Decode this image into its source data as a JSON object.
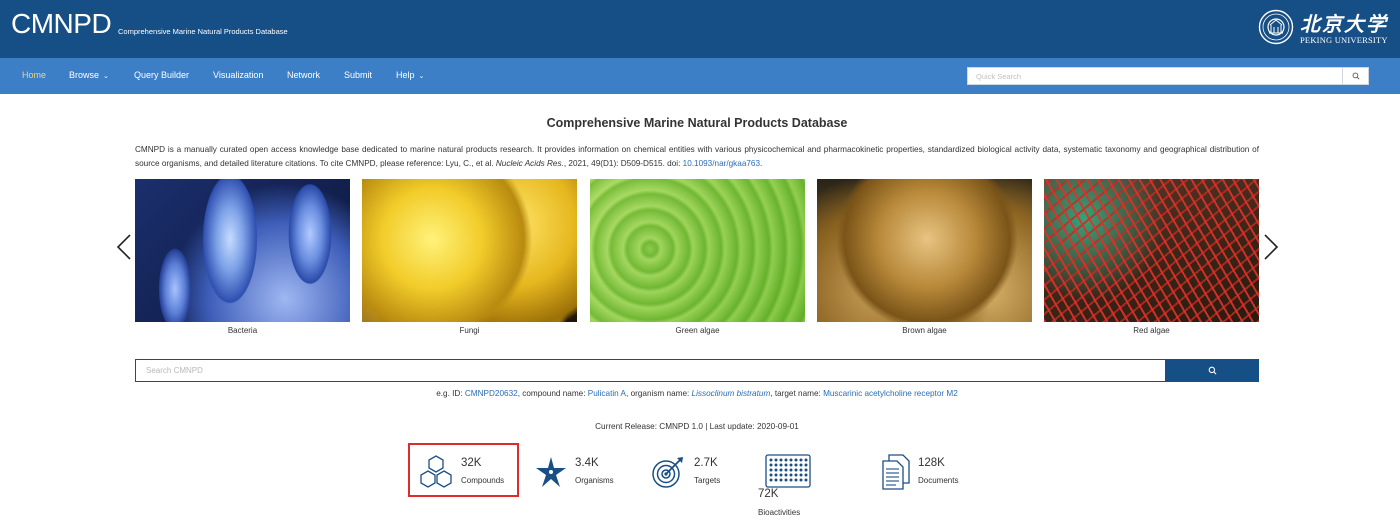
{
  "header": {
    "brand": "CMNPD",
    "brand_subtitle": "Comprehensive Marine Natural Products Database",
    "university_cn": "北京大学",
    "university_en": "PEKING UNIVERSITY"
  },
  "nav": {
    "items": [
      {
        "label": "Home",
        "active": true
      },
      {
        "label": "Browse",
        "dropdown": true
      },
      {
        "label": "Query Builder"
      },
      {
        "label": "Visualization"
      },
      {
        "label": "Network"
      },
      {
        "label": "Submit"
      },
      {
        "label": "Help",
        "dropdown": true
      }
    ],
    "caret": "⌄",
    "quick_search_placeholder": "Quick Search"
  },
  "main": {
    "title": "Comprehensive Marine Natural Products Database",
    "intro_text": "CMNPD is a manually curated open access knowledge base dedicated to marine natural products research. It provides information on chemical entities with various physicochemical and pharmacokinetic properties, standardized biological activity data, systematic taxonomy and geographical distribution of source organisms, and detailed literature citations. To cite CMNPD, please reference: Lyu, C., et al. ",
    "intro_journal": "Nucleic Acids Res.",
    "intro_cite_rest": ", 2021, 49(D1): D509-D515. doi: ",
    "intro_doi": "10.1093/nar/gkaa763",
    "intro_end": "."
  },
  "carousel": {
    "slides": [
      {
        "caption": "Bacteria"
      },
      {
        "caption": "Fungi"
      },
      {
        "caption": "Green algae"
      },
      {
        "caption": "Brown algae"
      },
      {
        "caption": "Red algae"
      }
    ]
  },
  "search": {
    "placeholder": "Search CMNPD",
    "eg_prefix": "e.g. ID: ",
    "eg_id": "CMNPD20632",
    "eg_compound_label": ", compound name: ",
    "eg_compound": "Pulicatin A",
    "eg_organism_label": ", organism name: ",
    "eg_organism": "Lissoclinum bistratum",
    "eg_target_label": ", target name: ",
    "eg_target": "Muscarinic acetylcholine receptor M2"
  },
  "release": {
    "text": "Current Release: CMNPD 1.0 | Last update: 2020-09-01"
  },
  "stats": [
    {
      "value": "32K",
      "label": "Compounds",
      "icon": "hexagon-molecule-icon"
    },
    {
      "value": "3.4K",
      "label": "Organisms",
      "icon": "starfish-icon"
    },
    {
      "value": "2.7K",
      "label": "Targets",
      "icon": "target-icon"
    },
    {
      "value": "72K",
      "label": "Bioactivities",
      "icon": "assay-plate-icon"
    },
    {
      "value": "128K",
      "label": "Documents",
      "icon": "documents-icon"
    }
  ],
  "colors": {
    "header_bg": "#164e86",
    "nav_bg": "#3d7fc6",
    "nav_active": "#f3d37a",
    "link": "#2a6db5",
    "highlight": "#e02b2b"
  }
}
